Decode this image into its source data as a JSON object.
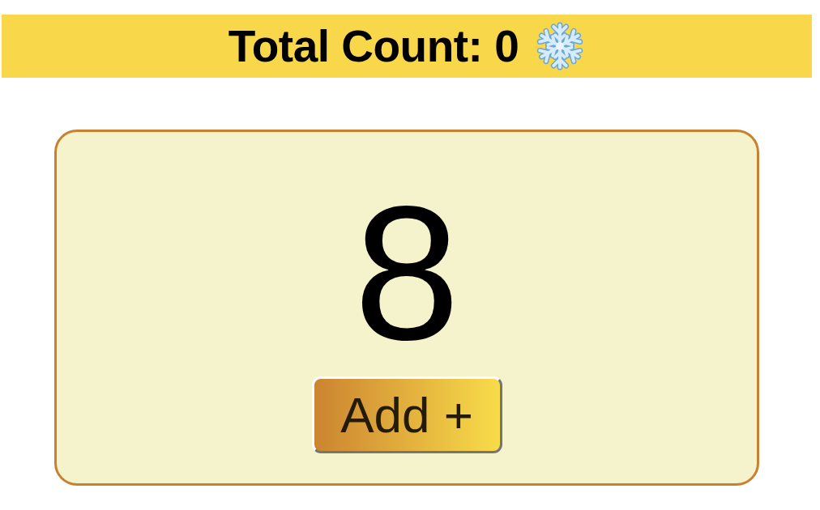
{
  "header": {
    "title": "Total Count: 0"
  },
  "counter": {
    "value": "8",
    "button": "Add +"
  }
}
